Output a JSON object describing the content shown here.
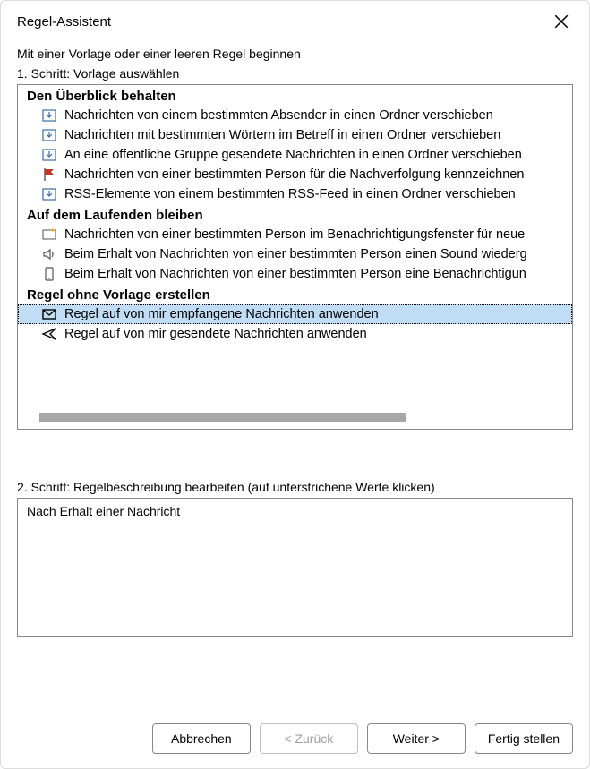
{
  "window": {
    "title": "Regel-Assistent"
  },
  "intro": "Mit einer Vorlage oder einer leeren Regel beginnen",
  "step1_label": "1. Schritt: Vorlage auswählen",
  "groups": {
    "overview_header": "Den Überblick behalten",
    "overview_items": {
      "0": "Nachrichten von einem bestimmten Absender in einen Ordner verschieben",
      "1": "Nachrichten mit bestimmten Wörtern im Betreff in einen Ordner verschieben",
      "2": "An eine öffentliche Gruppe gesendete Nachrichten in einen Ordner verschieben",
      "3": "Nachrichten von einer bestimmten Person für die Nachverfolgung kennzeichnen",
      "4": "RSS-Elemente von einem bestimmten RSS-Feed in einen Ordner verschieben"
    },
    "uptodate_header": "Auf dem Laufenden bleiben",
    "uptodate_items": {
      "0": "Nachrichten von einer bestimmten Person im Benachrichtigungsfenster für neue",
      "1": "Beim Erhalt von Nachrichten von einer bestimmten Person einen Sound wiederg",
      "2": "Beim Erhalt von Nachrichten von einer bestimmten Person eine Benachrichtigun"
    },
    "blank_header": "Regel ohne Vorlage erstellen",
    "blank_items": {
      "0": "Regel auf von mir empfangene Nachrichten anwenden",
      "1": "Regel auf von mir gesendete Nachrichten anwenden"
    }
  },
  "step2_label": "2. Schritt: Regelbeschreibung bearbeiten (auf unterstrichene Werte klicken)",
  "description": "Nach Erhalt einer Nachricht",
  "buttons": {
    "cancel": "Abbrechen",
    "back": "< Zurück",
    "next": "Weiter >",
    "finish": "Fertig stellen"
  }
}
